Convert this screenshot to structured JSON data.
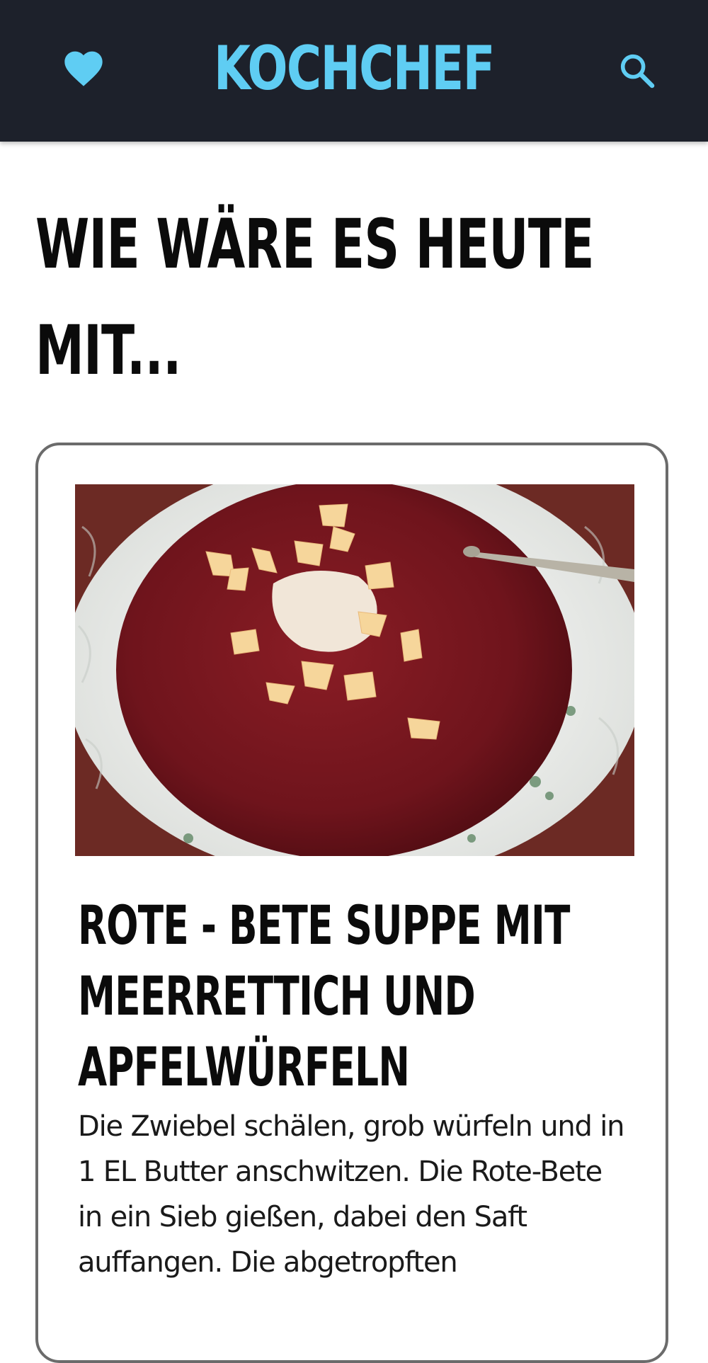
{
  "header": {
    "brand": "KOCHCHEF",
    "favorites_icon": "heart-icon",
    "search_icon": "search-icon",
    "accent_color": "#5fcdf3",
    "background_color": "#1d212b"
  },
  "main": {
    "headline": "WIE WÄRE ES HEUTE MIT...",
    "recipe": {
      "title": "ROTE - BETE SUPPE MIT MEERRETTICH UND APFELWÜRFELN",
      "description": "Die Zwiebel schälen, grob würfeln und in 1 EL Butter anschwitzen. Die Rote-Bete in ein Sieb gießen, dabei den Saft auffangen. Die abgetropften"
    }
  }
}
